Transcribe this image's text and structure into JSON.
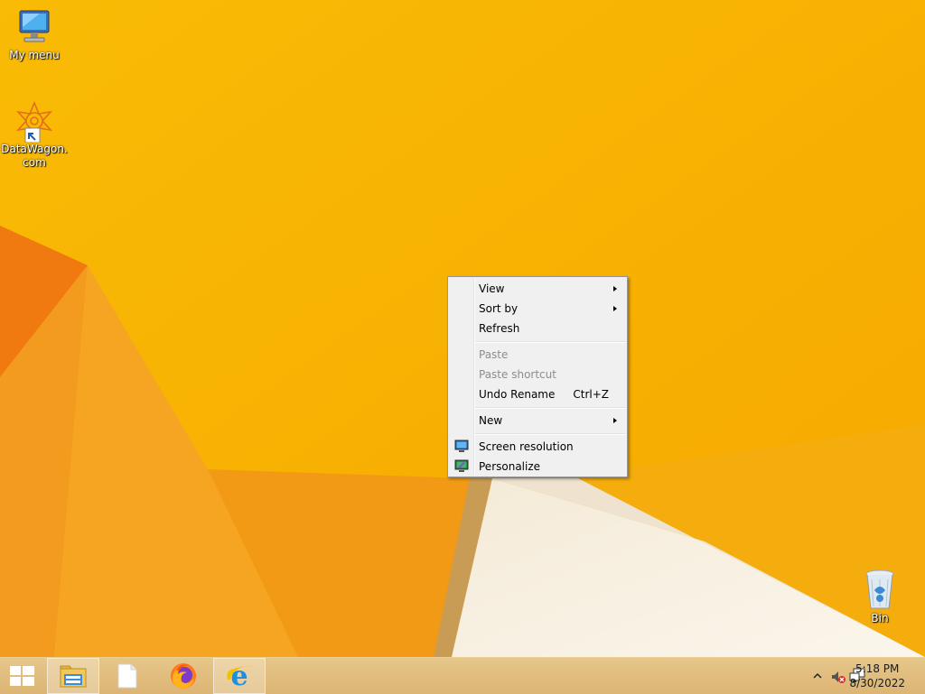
{
  "desktop": {
    "icons": [
      {
        "label": "My menu",
        "icon": "computer-icon"
      },
      {
        "label": "DataWagon.com",
        "icon": "datawagon-shortcut-icon"
      },
      {
        "label": "Bin",
        "icon": "recycle-bin-icon"
      }
    ]
  },
  "context_menu": {
    "items": {
      "view": {
        "label": "View"
      },
      "sort_by": {
        "label": "Sort by"
      },
      "refresh": {
        "label": "Refresh"
      },
      "paste": {
        "label": "Paste"
      },
      "paste_shortcut": {
        "label": "Paste shortcut"
      },
      "undo_rename": {
        "label": "Undo Rename",
        "shortcut": "Ctrl+Z"
      },
      "new": {
        "label": "New"
      },
      "screen_resolution": {
        "label": "Screen resolution",
        "icon": "display-icon"
      },
      "personalize": {
        "label": "Personalize",
        "icon": "personalize-icon"
      }
    }
  },
  "taskbar": {
    "pinned": [
      "file-explorer-icon",
      "document-icon",
      "firefox-icon",
      "internet-explorer-icon"
    ],
    "clock": {
      "time": "5:18 PM",
      "date": "8/30/2022"
    },
    "tray": [
      "show-hidden-icons-chevron",
      "speaker-muted-icon",
      "network-icon"
    ]
  },
  "colors": {
    "wallpaper": "#f7b500",
    "accent_orange": "#f08a00",
    "menu_bg": "#f0f0f0"
  }
}
